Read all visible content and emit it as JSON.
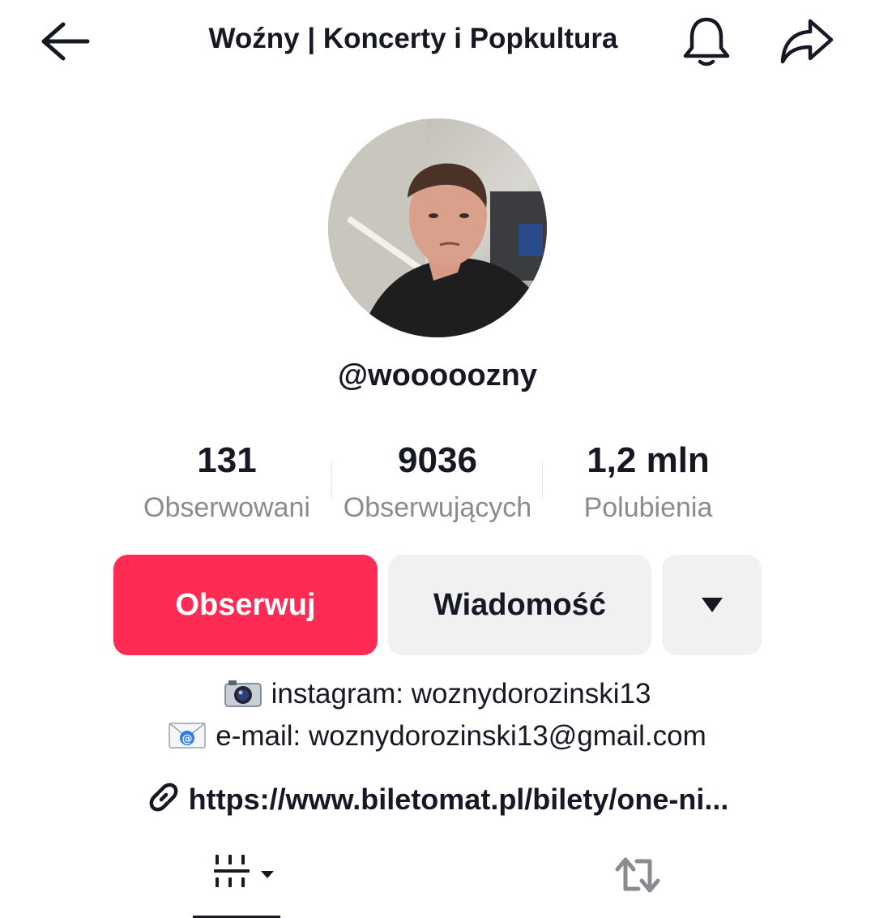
{
  "header": {
    "title": "Woźny | Koncerty i Popkultura",
    "icons": [
      "back-arrow-icon",
      "bell-icon",
      "share-icon"
    ]
  },
  "profile": {
    "username": "@wooooozny"
  },
  "stats": [
    {
      "value": "131",
      "label": "Obserwowani"
    },
    {
      "value": "9036",
      "label": "Obserwujących"
    },
    {
      "value": "1,2 mln",
      "label": "Polubienia"
    }
  ],
  "actions": {
    "follow_label": "Obserwuj",
    "message_label": "Wiadomość",
    "more_icon": "triangle-down-icon"
  },
  "bio": {
    "line1": "instagram: woznydorozinski13",
    "line2": "e-mail: woznydorozinski13@gmail.com",
    "link": "https://www.biletomat.pl/bilety/one-ni..."
  },
  "tabs": [
    {
      "icon": "videos-grid-icon",
      "active": true
    },
    {
      "icon": "repost-icon",
      "active": false
    }
  ],
  "colors": {
    "accent": "#fe2c55",
    "secondary_button": "#f1f1f2",
    "text": "#161823",
    "muted": "#8a8b91"
  }
}
